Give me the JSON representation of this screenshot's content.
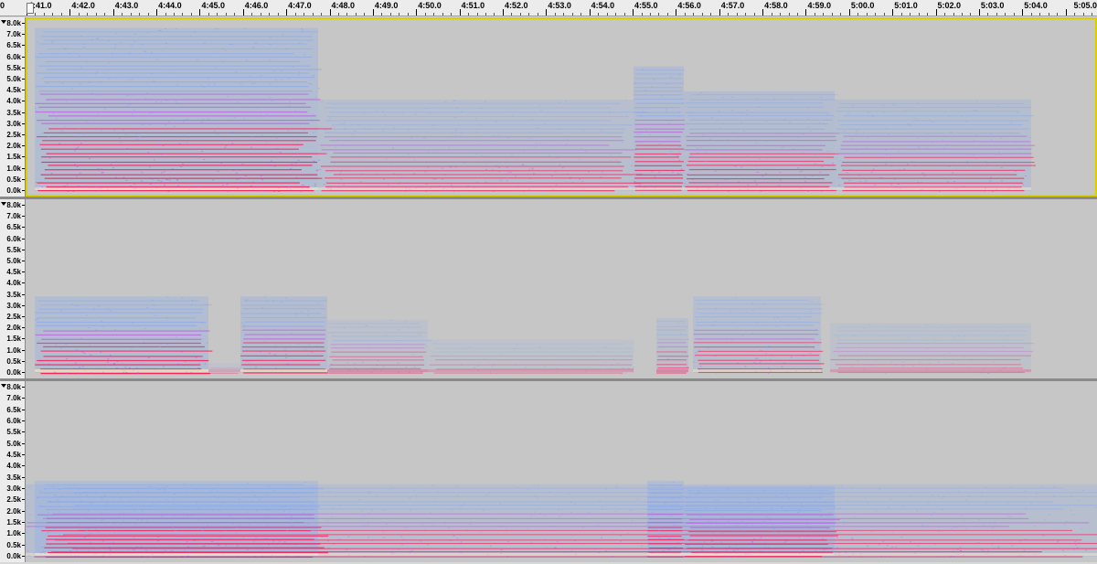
{
  "timeline": {
    "labels": [
      "0",
      "4:41.0",
      "4:42.0",
      "4:43.0",
      "4:44.0",
      "4:45.0",
      "4:46.0",
      "4:47.0",
      "4:48.0",
      "4:49.0",
      "4:50.0",
      "4:51.0",
      "4:52.0",
      "4:53.0",
      "4:54.0",
      "4:55.0",
      "4:56.0",
      "4:57.0",
      "4:58.0",
      "4:59.0",
      "5:00.0",
      "5:01.0",
      "5:02.0",
      "5:03.0",
      "5:04.0",
      "5:05.0"
    ]
  },
  "freq_scale": {
    "labels": [
      "8.0k",
      "7.0k",
      "6.5k",
      "6.0k",
      "5.5k",
      "5.0k",
      "4.5k",
      "4.0k",
      "3.5k",
      "3.0k",
      "2.5k",
      "2.0k",
      "1.5k",
      "1.0k",
      "0.5k",
      "0.0k"
    ]
  },
  "icons": {
    "track_menu": "dropdown-triangle-icon",
    "playhead": "playhead-marker-icon"
  },
  "colors": {
    "background": "#c6c6c6",
    "low_energy": "#7fa4f0",
    "mid_energy": "#c050e0",
    "high_energy": "#ff1a55",
    "peak": "#fff4c0",
    "selection": "#d8d000"
  },
  "tracks": [
    {
      "id": "track-1",
      "selected": true
    },
    {
      "id": "track-2",
      "selected": false
    },
    {
      "id": "track-3",
      "selected": false
    }
  ]
}
